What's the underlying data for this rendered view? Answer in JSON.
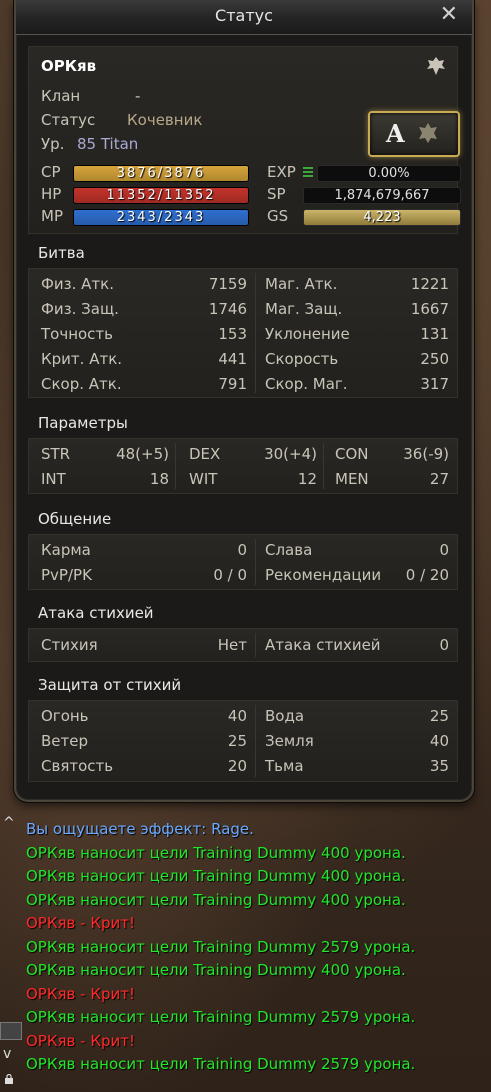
{
  "window": {
    "title": "Статус"
  },
  "character": {
    "name": "ОРКяв",
    "clan_label": "Клан",
    "clan_value": "-",
    "status_label": "Статус",
    "status_value": "Кочевник",
    "level_label": "Ур.",
    "level_value": "85 Titan",
    "grade": "A"
  },
  "bars": {
    "cp": {
      "label": "CP",
      "text": "3876/3876",
      "fill": 1.0,
      "color": "#d6a43a"
    },
    "hp": {
      "label": "HP",
      "text": "11352/11352",
      "fill": 1.0,
      "color": "#c2332b"
    },
    "mp": {
      "label": "MP",
      "text": "2343/2343",
      "fill": 1.0,
      "color": "#2f6fd0"
    },
    "exp": {
      "label": "EXP",
      "text": "0.00%"
    },
    "sp": {
      "label": "SP",
      "text": "1,874,679,667"
    },
    "gs": {
      "label": "GS",
      "text": "4,223"
    }
  },
  "battle": {
    "title": "Битва",
    "left": [
      {
        "label": "Физ. Атк.",
        "value": "7159"
      },
      {
        "label": "Физ. Защ.",
        "value": "1746"
      },
      {
        "label": "Точность",
        "value": "153"
      },
      {
        "label": "Крит. Атк.",
        "value": "441"
      },
      {
        "label": "Скор. Атк.",
        "value": "791"
      }
    ],
    "right": [
      {
        "label": "Маг. Атк.",
        "value": "1221"
      },
      {
        "label": "Маг. Защ.",
        "value": "1667"
      },
      {
        "label": "Уклонение",
        "value": "131"
      },
      {
        "label": "Скорость",
        "value": "250"
      },
      {
        "label": "Скор. Маг.",
        "value": "317"
      }
    ]
  },
  "params": {
    "title": "Параметры",
    "row1": [
      {
        "label": "STR",
        "value": "48(+5)"
      },
      {
        "label": "DEX",
        "value": "30(+4)"
      },
      {
        "label": "CON",
        "value": "36(-9)"
      }
    ],
    "row2": [
      {
        "label": "INT",
        "value": "18"
      },
      {
        "label": "WIT",
        "value": "12"
      },
      {
        "label": "MEN",
        "value": "27"
      }
    ]
  },
  "social": {
    "title": "Общение",
    "karma_label": "Карма",
    "karma_value": "0",
    "fame_label": "Слава",
    "fame_value": "0",
    "pvp_label": "PvP/PK",
    "pvp_value": "0 / 0",
    "rec_label": "Рекомендации",
    "rec_value": "0 / 20"
  },
  "element_attack": {
    "title": "Атака стихией",
    "elem_label": "Стихия",
    "elem_value": "Нет",
    "atk_label": "Атака стихией",
    "atk_value": "0"
  },
  "element_defense": {
    "title": "Защита от стихий",
    "left": [
      {
        "label": "Огонь",
        "value": "40"
      },
      {
        "label": "Ветер",
        "value": "25"
      },
      {
        "label": "Святость",
        "value": "20"
      }
    ],
    "right": [
      {
        "label": "Вода",
        "value": "25"
      },
      {
        "label": "Земля",
        "value": "40"
      },
      {
        "label": "Тьма",
        "value": "35"
      }
    ]
  },
  "chat": [
    {
      "text": "Вы ощущаете эффект: Rage.",
      "color": "blue"
    },
    {
      "text": "ОРКяв наносит цели Training Dummy 400 урона.",
      "color": "green"
    },
    {
      "text": "ОРКяв наносит цели Training Dummy 400 урона.",
      "color": "green"
    },
    {
      "text": "ОРКяв наносит цели Training Dummy 400 урона.",
      "color": "green"
    },
    {
      "text": "ОРКяв - Крит!",
      "color": "red"
    },
    {
      "text": "ОРКяв наносит цели Training Dummy 2579 урона.",
      "color": "green"
    },
    {
      "text": "ОРКяв наносит цели Training Dummy 400 урона.",
      "color": "green"
    },
    {
      "text": "ОРКяв - Крит!",
      "color": "red"
    },
    {
      "text": "ОРКяв наносит цели Training Dummy 2579 урона.",
      "color": "green"
    },
    {
      "text": "ОРКяв - Крит!",
      "color": "red"
    },
    {
      "text": "ОРКяв наносит цели Training Dummy 2579 урона.",
      "color": "green"
    }
  ]
}
